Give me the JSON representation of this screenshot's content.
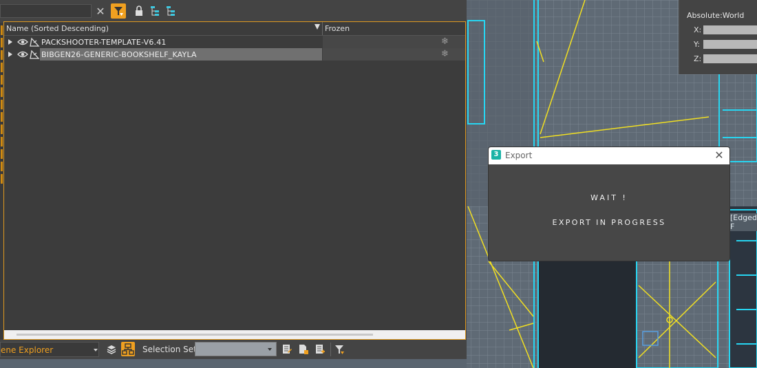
{
  "scene_explorer": {
    "columns": {
      "name": "Name (Sorted Descending)",
      "frozen": "Frozen"
    },
    "rows": [
      {
        "label": "PACKSHOOTER-TEMPLATE-V6.41"
      },
      {
        "label": "BIBGEN26-GENERIC-BOOKSHELF_KAYLA"
      }
    ],
    "frozen_glyph": "❄",
    "close_glyph": "✕",
    "bottom": {
      "explorer_name": "ene Explorer",
      "selection_set_label": "Selection Set:",
      "selection_set_value": ""
    },
    "accent_color": "#f0a020"
  },
  "transform": {
    "absolute_label": "Absolute:World",
    "x_label": "X:",
    "y_label": "Y:",
    "z_label": "Z:"
  },
  "viewport": {
    "view_label": "[Edged F"
  },
  "export_dialog": {
    "app_icon": "3",
    "title": "Export",
    "close_glyph": "✕",
    "message_wait": "WAIT !",
    "message_progress": "EXPORT IN PROGRESS"
  }
}
